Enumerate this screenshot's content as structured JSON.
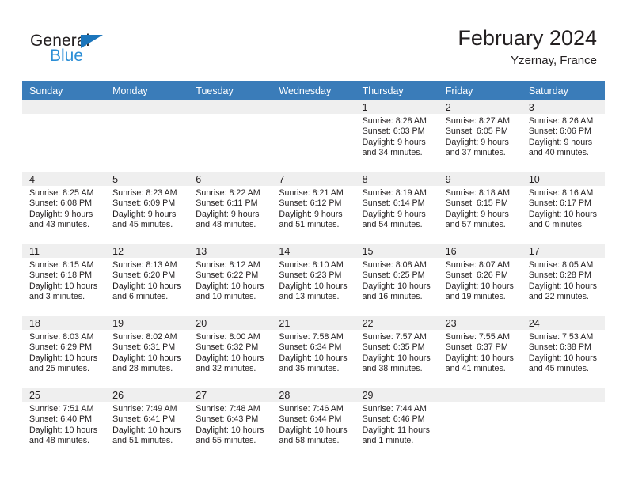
{
  "brand": {
    "name_dark": "General",
    "name_blue": "Blue",
    "accent_color": "#1b75bb",
    "accent_light": "#2b8ed6",
    "triangle_icon": "triangle-icon"
  },
  "header": {
    "title": "February 2024",
    "subtitle": "Yzernay, France"
  },
  "colors": {
    "header_row_bg": "#3a7cb9",
    "header_row_text": "#ffffff",
    "daynum_band_bg": "#efefef",
    "row_separator": "#2f6fad",
    "body_text": "#231f20"
  },
  "weekday_headers": [
    "Sunday",
    "Monday",
    "Tuesday",
    "Wednesday",
    "Thursday",
    "Friday",
    "Saturday"
  ],
  "weeks": [
    [
      {
        "day": "",
        "lines": []
      },
      {
        "day": "",
        "lines": []
      },
      {
        "day": "",
        "lines": []
      },
      {
        "day": "",
        "lines": []
      },
      {
        "day": "1",
        "lines": [
          "Sunrise: 8:28 AM",
          "Sunset: 6:03 PM",
          "Daylight: 9 hours",
          "and 34 minutes."
        ]
      },
      {
        "day": "2",
        "lines": [
          "Sunrise: 8:27 AM",
          "Sunset: 6:05 PM",
          "Daylight: 9 hours",
          "and 37 minutes."
        ]
      },
      {
        "day": "3",
        "lines": [
          "Sunrise: 8:26 AM",
          "Sunset: 6:06 PM",
          "Daylight: 9 hours",
          "and 40 minutes."
        ]
      }
    ],
    [
      {
        "day": "4",
        "lines": [
          "Sunrise: 8:25 AM",
          "Sunset: 6:08 PM",
          "Daylight: 9 hours",
          "and 43 minutes."
        ]
      },
      {
        "day": "5",
        "lines": [
          "Sunrise: 8:23 AM",
          "Sunset: 6:09 PM",
          "Daylight: 9 hours",
          "and 45 minutes."
        ]
      },
      {
        "day": "6",
        "lines": [
          "Sunrise: 8:22 AM",
          "Sunset: 6:11 PM",
          "Daylight: 9 hours",
          "and 48 minutes."
        ]
      },
      {
        "day": "7",
        "lines": [
          "Sunrise: 8:21 AM",
          "Sunset: 6:12 PM",
          "Daylight: 9 hours",
          "and 51 minutes."
        ]
      },
      {
        "day": "8",
        "lines": [
          "Sunrise: 8:19 AM",
          "Sunset: 6:14 PM",
          "Daylight: 9 hours",
          "and 54 minutes."
        ]
      },
      {
        "day": "9",
        "lines": [
          "Sunrise: 8:18 AM",
          "Sunset: 6:15 PM",
          "Daylight: 9 hours",
          "and 57 minutes."
        ]
      },
      {
        "day": "10",
        "lines": [
          "Sunrise: 8:16 AM",
          "Sunset: 6:17 PM",
          "Daylight: 10 hours",
          "and 0 minutes."
        ]
      }
    ],
    [
      {
        "day": "11",
        "lines": [
          "Sunrise: 8:15 AM",
          "Sunset: 6:18 PM",
          "Daylight: 10 hours",
          "and 3 minutes."
        ]
      },
      {
        "day": "12",
        "lines": [
          "Sunrise: 8:13 AM",
          "Sunset: 6:20 PM",
          "Daylight: 10 hours",
          "and 6 minutes."
        ]
      },
      {
        "day": "13",
        "lines": [
          "Sunrise: 8:12 AM",
          "Sunset: 6:22 PM",
          "Daylight: 10 hours",
          "and 10 minutes."
        ]
      },
      {
        "day": "14",
        "lines": [
          "Sunrise: 8:10 AM",
          "Sunset: 6:23 PM",
          "Daylight: 10 hours",
          "and 13 minutes."
        ]
      },
      {
        "day": "15",
        "lines": [
          "Sunrise: 8:08 AM",
          "Sunset: 6:25 PM",
          "Daylight: 10 hours",
          "and 16 minutes."
        ]
      },
      {
        "day": "16",
        "lines": [
          "Sunrise: 8:07 AM",
          "Sunset: 6:26 PM",
          "Daylight: 10 hours",
          "and 19 minutes."
        ]
      },
      {
        "day": "17",
        "lines": [
          "Sunrise: 8:05 AM",
          "Sunset: 6:28 PM",
          "Daylight: 10 hours",
          "and 22 minutes."
        ]
      }
    ],
    [
      {
        "day": "18",
        "lines": [
          "Sunrise: 8:03 AM",
          "Sunset: 6:29 PM",
          "Daylight: 10 hours",
          "and 25 minutes."
        ]
      },
      {
        "day": "19",
        "lines": [
          "Sunrise: 8:02 AM",
          "Sunset: 6:31 PM",
          "Daylight: 10 hours",
          "and 28 minutes."
        ]
      },
      {
        "day": "20",
        "lines": [
          "Sunrise: 8:00 AM",
          "Sunset: 6:32 PM",
          "Daylight: 10 hours",
          "and 32 minutes."
        ]
      },
      {
        "day": "21",
        "lines": [
          "Sunrise: 7:58 AM",
          "Sunset: 6:34 PM",
          "Daylight: 10 hours",
          "and 35 minutes."
        ]
      },
      {
        "day": "22",
        "lines": [
          "Sunrise: 7:57 AM",
          "Sunset: 6:35 PM",
          "Daylight: 10 hours",
          "and 38 minutes."
        ]
      },
      {
        "day": "23",
        "lines": [
          "Sunrise: 7:55 AM",
          "Sunset: 6:37 PM",
          "Daylight: 10 hours",
          "and 41 minutes."
        ]
      },
      {
        "day": "24",
        "lines": [
          "Sunrise: 7:53 AM",
          "Sunset: 6:38 PM",
          "Daylight: 10 hours",
          "and 45 minutes."
        ]
      }
    ],
    [
      {
        "day": "25",
        "lines": [
          "Sunrise: 7:51 AM",
          "Sunset: 6:40 PM",
          "Daylight: 10 hours",
          "and 48 minutes."
        ]
      },
      {
        "day": "26",
        "lines": [
          "Sunrise: 7:49 AM",
          "Sunset: 6:41 PM",
          "Daylight: 10 hours",
          "and 51 minutes."
        ]
      },
      {
        "day": "27",
        "lines": [
          "Sunrise: 7:48 AM",
          "Sunset: 6:43 PM",
          "Daylight: 10 hours",
          "and 55 minutes."
        ]
      },
      {
        "day": "28",
        "lines": [
          "Sunrise: 7:46 AM",
          "Sunset: 6:44 PM",
          "Daylight: 10 hours",
          "and 58 minutes."
        ]
      },
      {
        "day": "29",
        "lines": [
          "Sunrise: 7:44 AM",
          "Sunset: 6:46 PM",
          "Daylight: 11 hours",
          "and 1 minute."
        ]
      },
      {
        "day": "",
        "lines": []
      },
      {
        "day": "",
        "lines": []
      }
    ]
  ]
}
